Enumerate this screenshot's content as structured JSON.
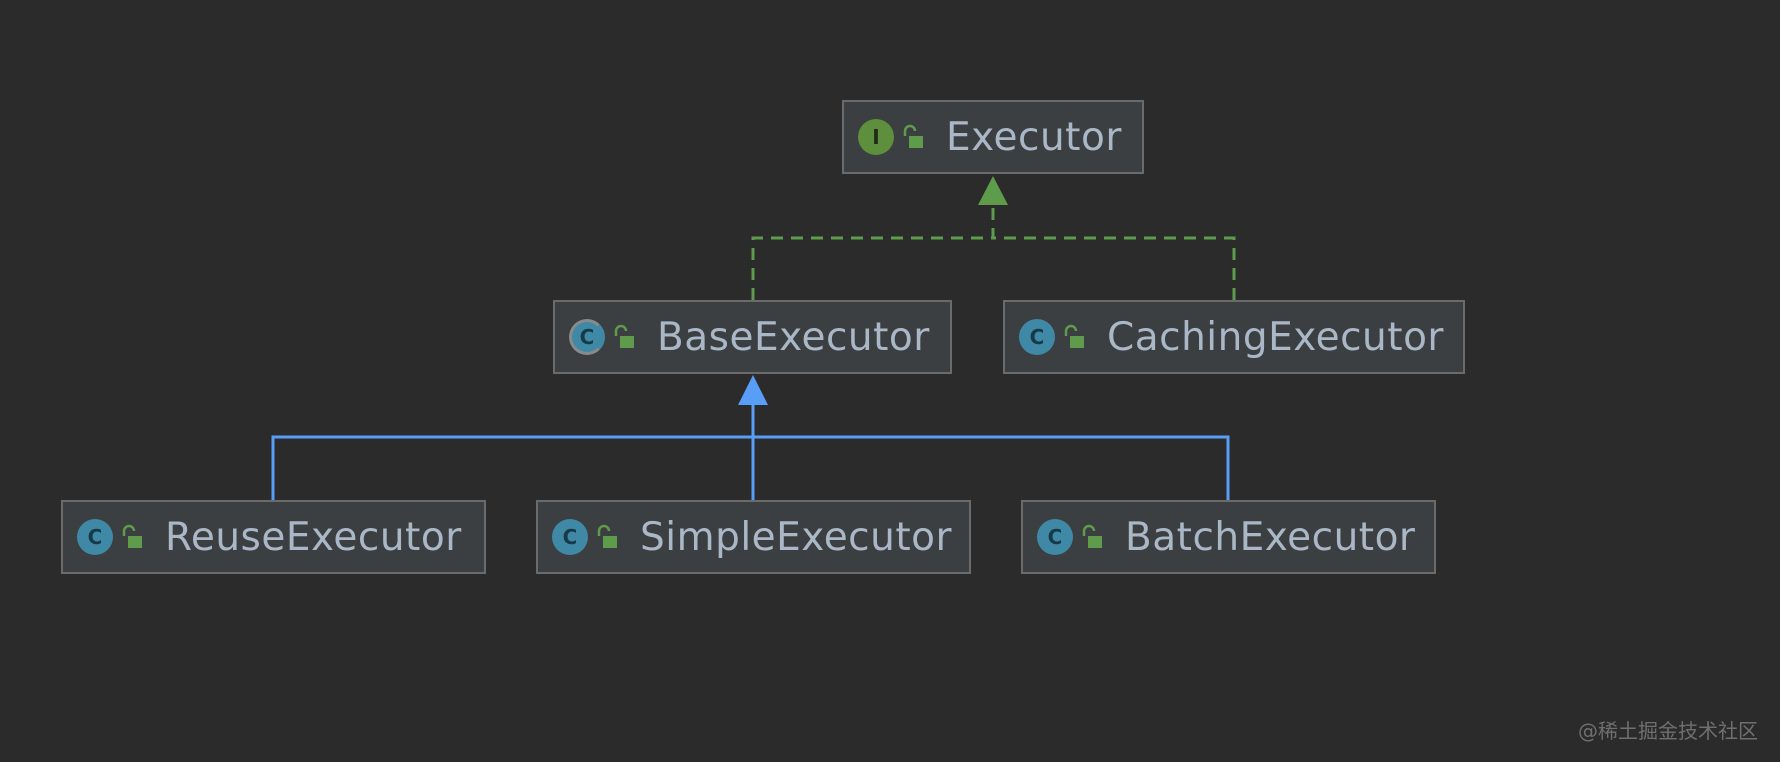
{
  "diagram": {
    "nodes": [
      {
        "id": "executor",
        "label": "Executor",
        "kind": "interface",
        "kind_letter": "I",
        "visibility_icon": "unlock-icon"
      },
      {
        "id": "base",
        "label": "BaseExecutor",
        "kind": "abstract",
        "kind_letter": "C",
        "visibility_icon": "unlock-icon"
      },
      {
        "id": "caching",
        "label": "CachingExecutor",
        "kind": "class",
        "kind_letter": "C",
        "visibility_icon": "unlock-icon"
      },
      {
        "id": "reuse",
        "label": "ReuseExecutor",
        "kind": "class",
        "kind_letter": "C",
        "visibility_icon": "unlock-icon"
      },
      {
        "id": "simple",
        "label": "SimpleExecutor",
        "kind": "class",
        "kind_letter": "C",
        "visibility_icon": "unlock-icon"
      },
      {
        "id": "batch",
        "label": "BatchExecutor",
        "kind": "class",
        "kind_letter": "C",
        "visibility_icon": "unlock-icon"
      }
    ],
    "edges": [
      {
        "from": "base",
        "to": "executor",
        "type": "implements"
      },
      {
        "from": "caching",
        "to": "executor",
        "type": "implements"
      },
      {
        "from": "reuse",
        "to": "base",
        "type": "extends"
      },
      {
        "from": "simple",
        "to": "base",
        "type": "extends"
      },
      {
        "from": "batch",
        "to": "base",
        "type": "extends"
      }
    ],
    "colors": {
      "implements": "#5e9b4a",
      "extends": "#589df6"
    }
  },
  "watermark": "@稀土掘金技术社区"
}
